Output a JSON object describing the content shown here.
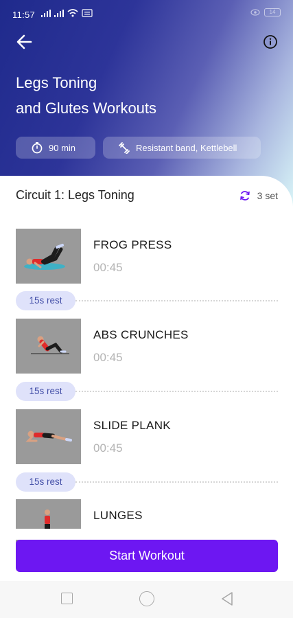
{
  "status_bar": {
    "time": "11:57",
    "battery": "14"
  },
  "header": {
    "title_line1": "Legs Toning",
    "title_line2": "and Glutes Workouts"
  },
  "chips": {
    "duration": "90 min",
    "equipment": "Resistant band, Kettlebell"
  },
  "circuit": {
    "title": "Circuit 1: Legs Toning",
    "sets": "3 set"
  },
  "exercises": [
    {
      "name": "FROG PRESS",
      "duration": "00:45"
    },
    {
      "name": "ABS CRUNCHES",
      "duration": "00:45"
    },
    {
      "name": "SLIDE PLANK",
      "duration": "00:45"
    },
    {
      "name": "LUNGES",
      "duration": ""
    }
  ],
  "rests": [
    "15s rest",
    "15s rest",
    "15s rest"
  ],
  "start_button": "Start Workout",
  "colors": {
    "accent": "#6d17f2",
    "rest_pill": "#dfe2fa",
    "rest_text": "#4450a8",
    "hero_dark": "#1f2a8c"
  },
  "icons": [
    "back-arrow-icon",
    "info-icon",
    "stopwatch-icon",
    "dumbbell-icon",
    "repeat-icon"
  ]
}
